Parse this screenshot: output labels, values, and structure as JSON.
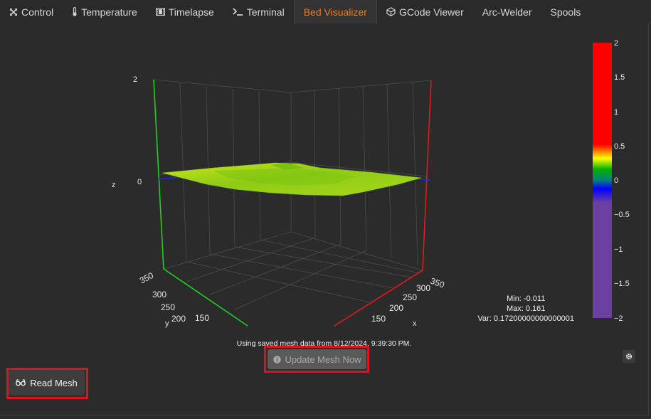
{
  "tabs": [
    {
      "label": "Control",
      "icon": "arrows-move-icon"
    },
    {
      "label": "Temperature",
      "icon": "thermometer-icon"
    },
    {
      "label": "Timelapse",
      "icon": "film-icon"
    },
    {
      "label": "Terminal",
      "icon": "terminal-icon"
    },
    {
      "label": "Bed Visualizer",
      "icon": "",
      "active": true
    },
    {
      "label": "GCode Viewer",
      "icon": "cube-icon"
    },
    {
      "label": "Arc-Welder",
      "icon": ""
    },
    {
      "label": "Spools",
      "icon": ""
    }
  ],
  "plot": {
    "z_axis_title": "z",
    "z_ticks": [
      "2",
      "0"
    ],
    "y_axis_title": "y",
    "y_ticks": [
      "350",
      "300",
      "250",
      "200",
      "150"
    ],
    "x_axis_title": "x",
    "x_ticks": [
      "350",
      "300",
      "250",
      "200",
      "150"
    ]
  },
  "colorbar": {
    "ticks": [
      "2",
      "1.5",
      "1",
      "0.5",
      "0",
      "−0.5",
      "−1",
      "−1.5",
      "−2"
    ],
    "range": [
      -2,
      2
    ]
  },
  "stats": {
    "min": "Min: -0.011",
    "max": "Max: 0.161",
    "var": "Var: 0.17200000000000001"
  },
  "mesh_note": "Using saved mesh data from 8/12/2024, 9:39:30 PM.",
  "buttons": {
    "update_mesh": "Update Mesh Now",
    "read_mesh": "Read Mesh"
  },
  "colors": {
    "accent": "#f07b1a",
    "highlight_box": "#e0121b",
    "x_axis": "#e11b1b",
    "y_axis": "#1fcf1f",
    "z_axis_blue": "#1b2ee0",
    "surface": "#9ccf1c"
  }
}
